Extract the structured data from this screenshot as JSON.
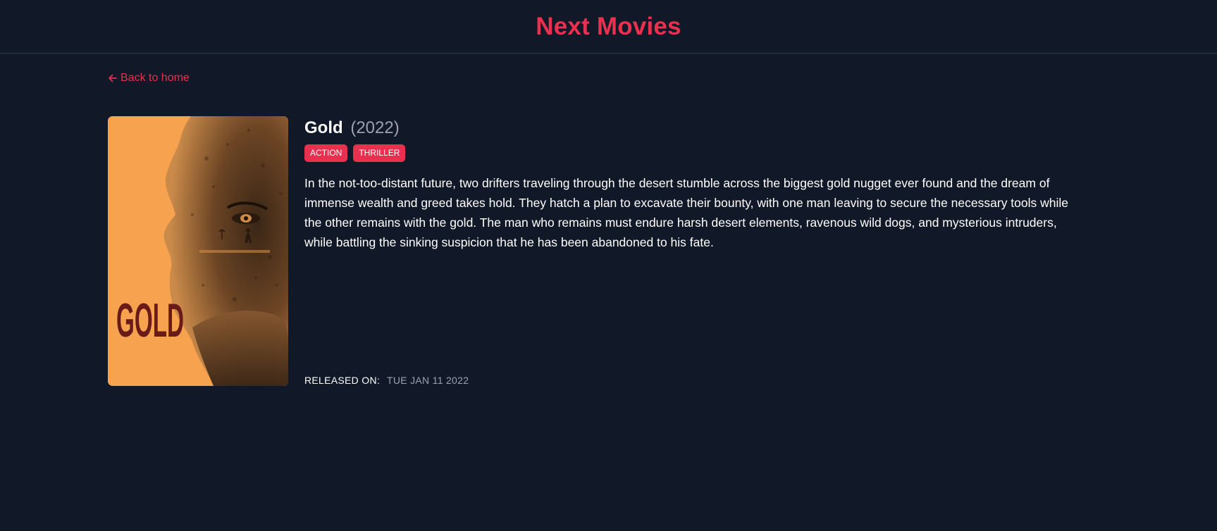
{
  "app": {
    "title": "Next Movies"
  },
  "nav": {
    "back_label": "Back to home"
  },
  "movie": {
    "title": "Gold",
    "year": "(2022)",
    "genres": [
      "ACTION",
      "THRILLER"
    ],
    "overview": "In the not-too-distant future, two drifters traveling through the desert stumble across the biggest gold nugget ever found and the dream of immense wealth and greed takes hold. They hatch a plan to excavate their bounty, with one man leaving to secure the necessary tools while the other remains with the gold. The man who remains must endure harsh desert elements, ravenous wild dogs, and mysterious intruders, while battling the sinking suspicion that he has been abandoned to his fate.",
    "released_label": "RELEASED ON:",
    "released_value": "TUE JAN 11 2022",
    "poster_text": "GOLD"
  },
  "colors": {
    "background": "#111827",
    "accent": "#e8304f",
    "muted": "#9ca3af",
    "poster_orange": "#f6a24e",
    "poster_text": "#6b1a1a"
  },
  "icons": {
    "back": "arrow-left-icon"
  }
}
